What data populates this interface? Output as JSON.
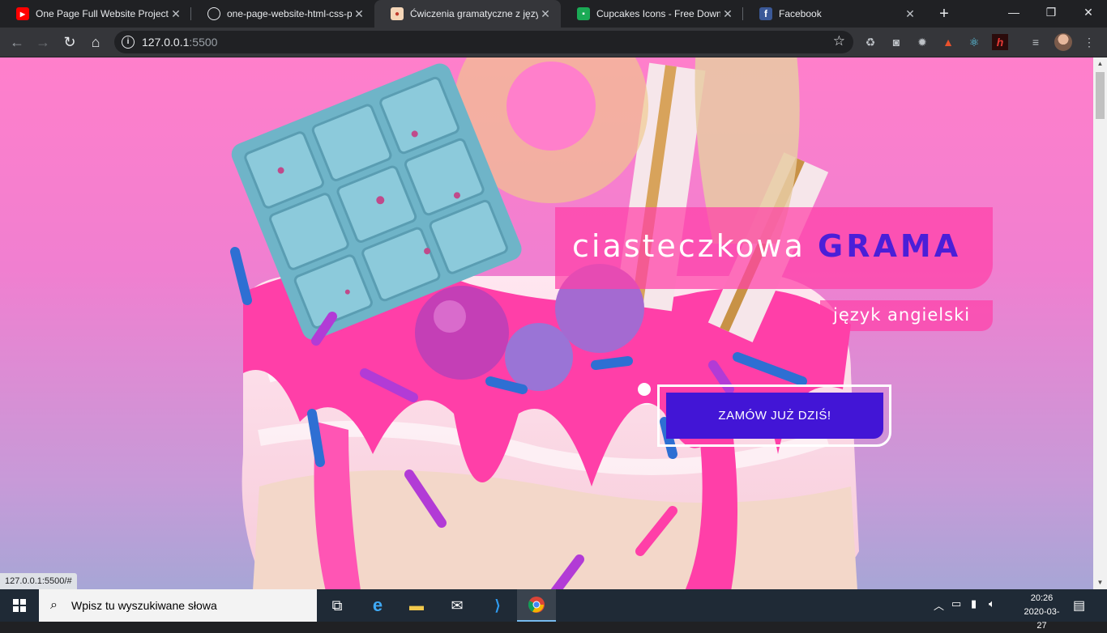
{
  "browser": {
    "tabs": [
      {
        "title": "One Page Full Website Project",
        "favicon": "youtube-icon",
        "active": false
      },
      {
        "title": "one-page-website-html-css-pr",
        "favicon": "github-icon",
        "active": false
      },
      {
        "title": "Ćwiczenia gramatyczne z język",
        "favicon": "cupcake-icon",
        "active": true
      },
      {
        "title": "Cupcakes Icons - Free Downloa",
        "favicon": "flaticon-icon",
        "active": false
      },
      {
        "title": "Facebook",
        "favicon": "facebook-icon",
        "active": false
      }
    ],
    "url_host": "127.0.0.1",
    "url_port": ":5500",
    "status_url": "127.0.0.1:5500/#"
  },
  "page": {
    "brand_light": "ciasteczkowa",
    "brand_bold": "GRAMA",
    "subtitle": "język angielski",
    "cta_label": "ZAMÓW JUŻ DZIŚ!"
  },
  "taskbar": {
    "search_placeholder": "Wpisz tu wyszukiwane słowa",
    "time": "20:26",
    "date": "2020-03-27"
  },
  "colors": {
    "accent": "#4215d6",
    "brand_bold": "#4a1fd8",
    "pink_overlay": "#ff40a8"
  }
}
